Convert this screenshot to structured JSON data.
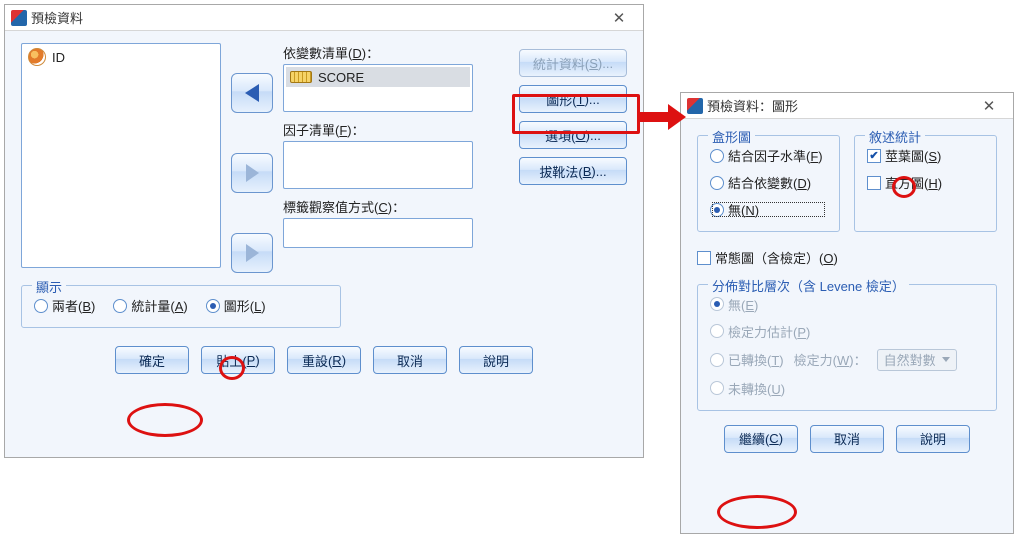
{
  "main": {
    "title": "預檢資料",
    "var_list_item": "ID",
    "dep_label_pre": "依變數清單(",
    "dep_hot": "D",
    "dep_label_post": ")：",
    "dep_item": "SCORE",
    "factor_label_pre": "因子清單(",
    "factor_hot": "F",
    "factor_label_post": ")：",
    "label_cases_pre": "標籤觀察值方式(",
    "label_cases_hot": "C",
    "label_cases_post": ")：",
    "side": {
      "stats_pre": "統計資料(",
      "stats_hot": "S",
      "stats_post": ")...",
      "plots_pre": "圖形(",
      "plots_hot": "T",
      "plots_post": ")...",
      "options_pre": "選項(",
      "options_hot": "O",
      "options_post": ")...",
      "boot_pre": "拔靴法(",
      "boot_hot": "B",
      "boot_post": ")..."
    },
    "display_legend": "顯示",
    "display_both_pre": "兩者(",
    "display_both_hot": "B",
    "display_both_post": ")",
    "display_stats_pre": "統計量(",
    "display_stats_hot": "A",
    "display_stats_post": ")",
    "display_plots_pre": "圖形(",
    "display_plots_hot": "L",
    "display_plots_post": ")",
    "buttons": {
      "ok": "確定",
      "paste_pre": "貼上(",
      "paste_hot": "P",
      "paste_post": ")",
      "reset_pre": "重設(",
      "reset_hot": "R",
      "reset_post": ")",
      "cancel": "取消",
      "help": "說明"
    }
  },
  "plots": {
    "title": "預檢資料：圖形",
    "box_legend": "盒形圖",
    "box_factor_pre": "結合因子水準(",
    "box_factor_hot": "F",
    "box_factor_post": ")",
    "box_dep_pre": "結合依變數(",
    "box_dep_hot": "D",
    "box_dep_post": ")",
    "box_none_pre": "無(",
    "box_none_hot": "N",
    "box_none_post": ")",
    "desc_legend": "敘述統計",
    "stem_pre": "莖葉圖(",
    "stem_hot": "S",
    "stem_post": ")",
    "hist_pre": "直方圖(",
    "hist_hot": "H",
    "hist_post": ")",
    "norm_pre": "常態圖（含檢定）(",
    "norm_hot": "O",
    "norm_post": ")",
    "spread_legend": "分佈對比層次（含 Levene 檢定）",
    "sv_none_pre": "無(",
    "sv_none_hot": "E",
    "sv_none_post": ")",
    "sv_power_pre": "檢定力估計(",
    "sv_power_hot": "P",
    "sv_power_post": ")",
    "sv_trans_pre": "已轉換(",
    "sv_trans_hot": "T",
    "sv_trans_post": ")",
    "sv_power_lbl_pre": "檢定力(",
    "sv_power_lbl_hot": "W",
    "sv_power_lbl_post": ")：",
    "sv_power_select": "自然對數",
    "sv_untrans_pre": "未轉換(",
    "sv_untrans_hot": "U",
    "sv_untrans_post": ")",
    "buttons": {
      "continue_pre": "繼續(",
      "continue_hot": "C",
      "continue_post": ")",
      "cancel": "取消",
      "help": "說明"
    }
  }
}
